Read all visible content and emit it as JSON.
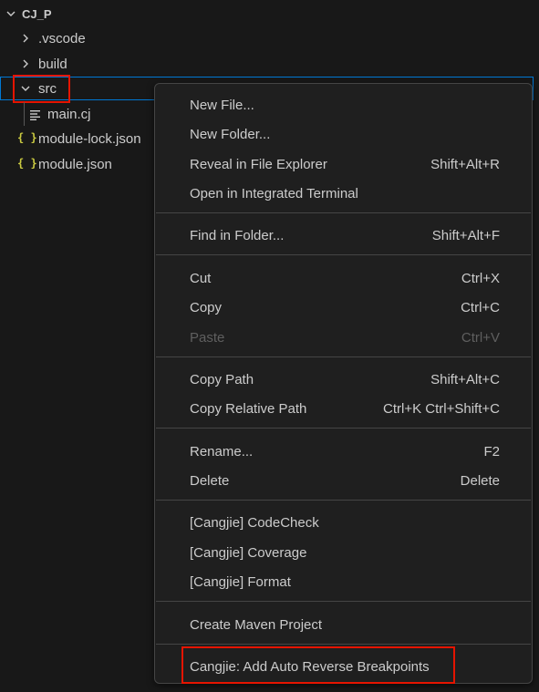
{
  "explorer": {
    "root_label": "CJ_P",
    "items": [
      {
        "label": ".vscode",
        "type": "folder",
        "expanded": false
      },
      {
        "label": "build",
        "type": "folder",
        "expanded": false
      },
      {
        "label": "src",
        "type": "folder",
        "expanded": true
      },
      {
        "label": "main.cj",
        "type": "file"
      },
      {
        "label": "module-lock.json",
        "type": "json"
      },
      {
        "label": "module.json",
        "type": "json"
      }
    ],
    "json_glyph": "{ }",
    "colors": {
      "selection_border": "#0078d4",
      "highlight": "#e51400",
      "json_icon": "#cbcb41"
    }
  },
  "context_menu": {
    "items": [
      {
        "label": "New File...",
        "shortcut": ""
      },
      {
        "label": "New Folder...",
        "shortcut": ""
      },
      {
        "label": "Reveal in File Explorer",
        "shortcut": "Shift+Alt+R"
      },
      {
        "label": "Open in Integrated Terminal",
        "shortcut": ""
      },
      {
        "label": "Find in Folder...",
        "shortcut": "Shift+Alt+F"
      },
      {
        "label": "Cut",
        "shortcut": "Ctrl+X"
      },
      {
        "label": "Copy",
        "shortcut": "Ctrl+C"
      },
      {
        "label": "Paste",
        "shortcut": "Ctrl+V",
        "disabled": true
      },
      {
        "label": "Copy Path",
        "shortcut": "Shift+Alt+C"
      },
      {
        "label": "Copy Relative Path",
        "shortcut": "Ctrl+K Ctrl+Shift+C"
      },
      {
        "label": "Rename...",
        "shortcut": "F2"
      },
      {
        "label": "Delete",
        "shortcut": "Delete"
      },
      {
        "label": "[Cangjie] CodeCheck",
        "shortcut": ""
      },
      {
        "label": "[Cangjie] Coverage",
        "shortcut": ""
      },
      {
        "label": "[Cangjie] Format",
        "shortcut": ""
      },
      {
        "label": "Create Maven Project",
        "shortcut": ""
      },
      {
        "label": "Cangjie: Add Auto Reverse Breakpoints",
        "shortcut": ""
      }
    ]
  }
}
